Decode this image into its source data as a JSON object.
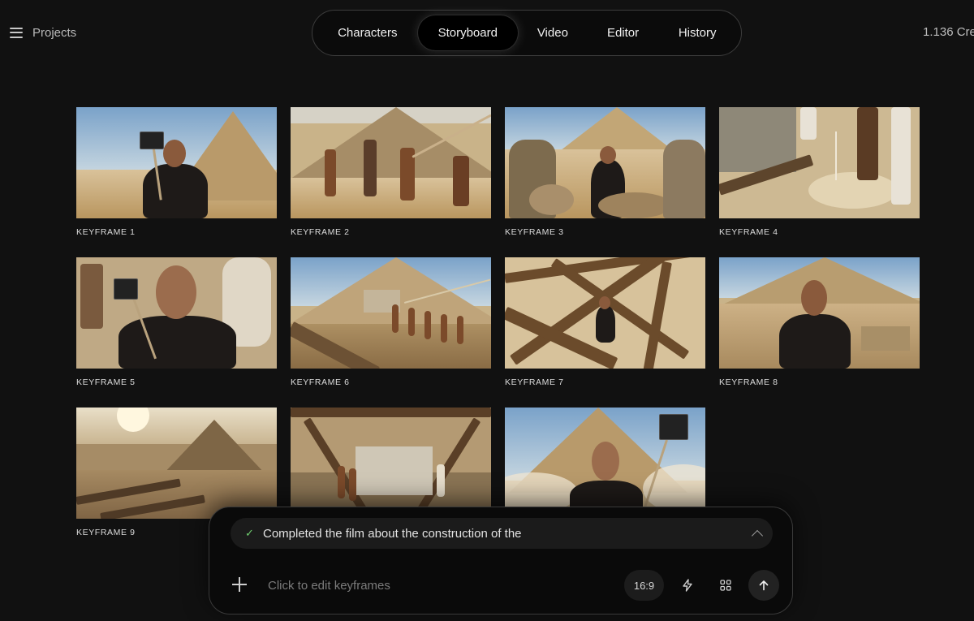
{
  "header": {
    "projects_label": "Projects",
    "credits": "1.136 Cre",
    "tabs": [
      {
        "label": "Characters",
        "active": false
      },
      {
        "label": "Storyboard",
        "active": true
      },
      {
        "label": "Video",
        "active": false
      },
      {
        "label": "Editor",
        "active": false
      },
      {
        "label": "History",
        "active": false
      }
    ]
  },
  "keyframes": [
    {
      "label": "KEYFRAME 1"
    },
    {
      "label": "KEYFRAME 2"
    },
    {
      "label": "KEYFRAME 3"
    },
    {
      "label": "KEYFRAME 4"
    },
    {
      "label": "KEYFRAME 5"
    },
    {
      "label": "KEYFRAME 6"
    },
    {
      "label": "KEYFRAME 7"
    },
    {
      "label": "KEYFRAME 8"
    },
    {
      "label": "KEYFRAME 9"
    },
    {
      "label": ""
    },
    {
      "label": ""
    }
  ],
  "chat": {
    "status_text": "Completed the film about the construction of the",
    "input_placeholder": "Click to edit keyframes",
    "aspect_ratio": "16:9"
  },
  "icons": {
    "menu": "hamburger-menu-icon",
    "status": "check-icon",
    "expand": "chevron-up-icon",
    "add": "plus-icon",
    "quick": "lightning-bolt-icon",
    "grid": "grid-icon",
    "send": "arrow-up-icon"
  },
  "colors": {
    "background": "#111111",
    "panel": "#0a0a0a",
    "check": "#6fcf6f"
  }
}
